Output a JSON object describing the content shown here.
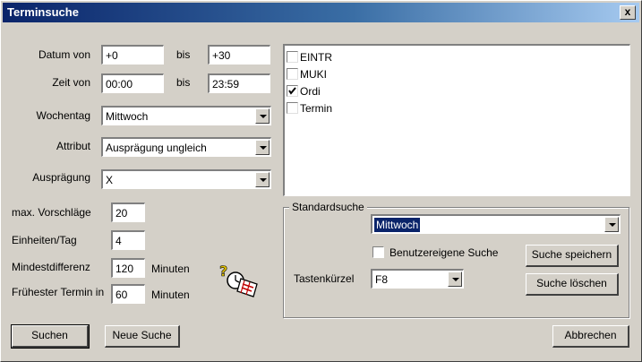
{
  "window": {
    "title": "Terminsuche",
    "close_label": "x"
  },
  "form": {
    "datum_von": {
      "label": "Datum von",
      "value": "+0",
      "bis_label": "bis",
      "bis_value": "+30"
    },
    "zeit_von": {
      "label": "Zeit von",
      "value": "00:00",
      "bis_label": "bis",
      "bis_value": "23:59"
    },
    "wochentag": {
      "label": "Wochentag",
      "value": "Mittwoch"
    },
    "attribut": {
      "label": "Attribut",
      "value": "Ausprägung ungleich"
    },
    "auspraegung": {
      "label": "Ausprägung",
      "value": "X"
    },
    "max_vorschlaege": {
      "label": "max. Vorschläge",
      "value": "20"
    },
    "einheiten_tag": {
      "label": "Einheiten/Tag",
      "value": "4"
    },
    "mindestdifferenz": {
      "label": "Mindestdifferenz",
      "value": "120",
      "unit": "Minuten"
    },
    "fruehester_termin": {
      "label": "Frühester Termin in",
      "value": "60",
      "unit": "Minuten"
    }
  },
  "categories": [
    {
      "label": "EINTR",
      "checked": false
    },
    {
      "label": "MUKI",
      "checked": false
    },
    {
      "label": "Ordi",
      "checked": true
    },
    {
      "label": "Termin",
      "checked": false
    }
  ],
  "standardsuche": {
    "title": "Standardsuche",
    "selected": "Mittwoch",
    "benutzereigene_label": "Benutzereigene Suche",
    "benutzereigene_checked": false,
    "tastenkuerzel_label": "Tastenkürzel",
    "tastenkuerzel_value": "F8",
    "save_button": "Suche speichern",
    "delete_button": "Suche löschen"
  },
  "buttons": {
    "suchen": "Suchen",
    "neue_suche": "Neue Suche",
    "abbrechen": "Abbrechen"
  },
  "icons": {
    "wizard": "search-wizard-icon"
  },
  "colors": {
    "titlebar": "#0a246a",
    "face": "#d4d0c8",
    "selection": "#0a246a"
  }
}
